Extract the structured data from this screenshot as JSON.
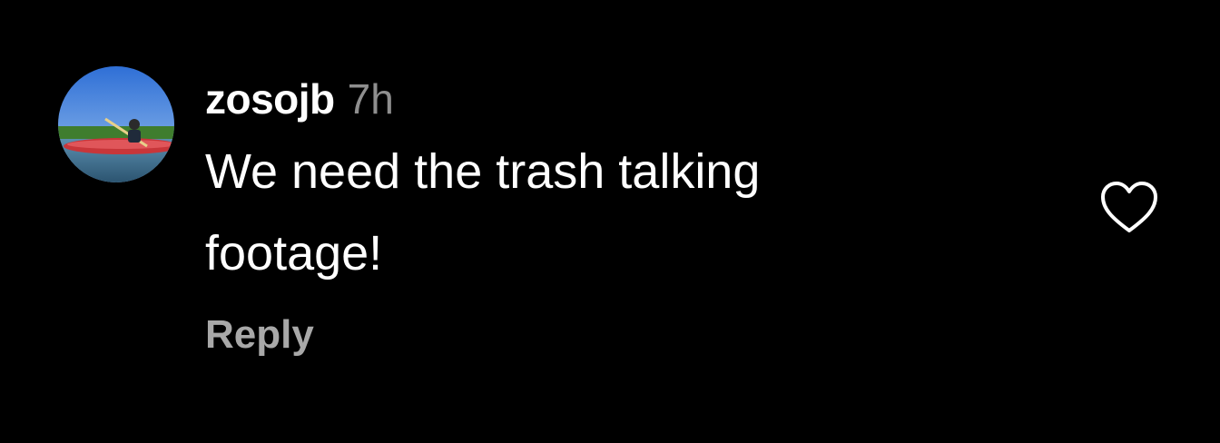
{
  "comment": {
    "username": "zosojb",
    "time": "7h",
    "text": "We need the trash talking footage!",
    "reply_label": "Reply"
  },
  "icons": {
    "avatar": "profile-photo",
    "like": "heart-outline-icon"
  },
  "colors": {
    "background": "#000000",
    "primary_text": "#ffffff",
    "secondary_text": "#8e8e8e",
    "reply_text": "#a8a8a8"
  }
}
